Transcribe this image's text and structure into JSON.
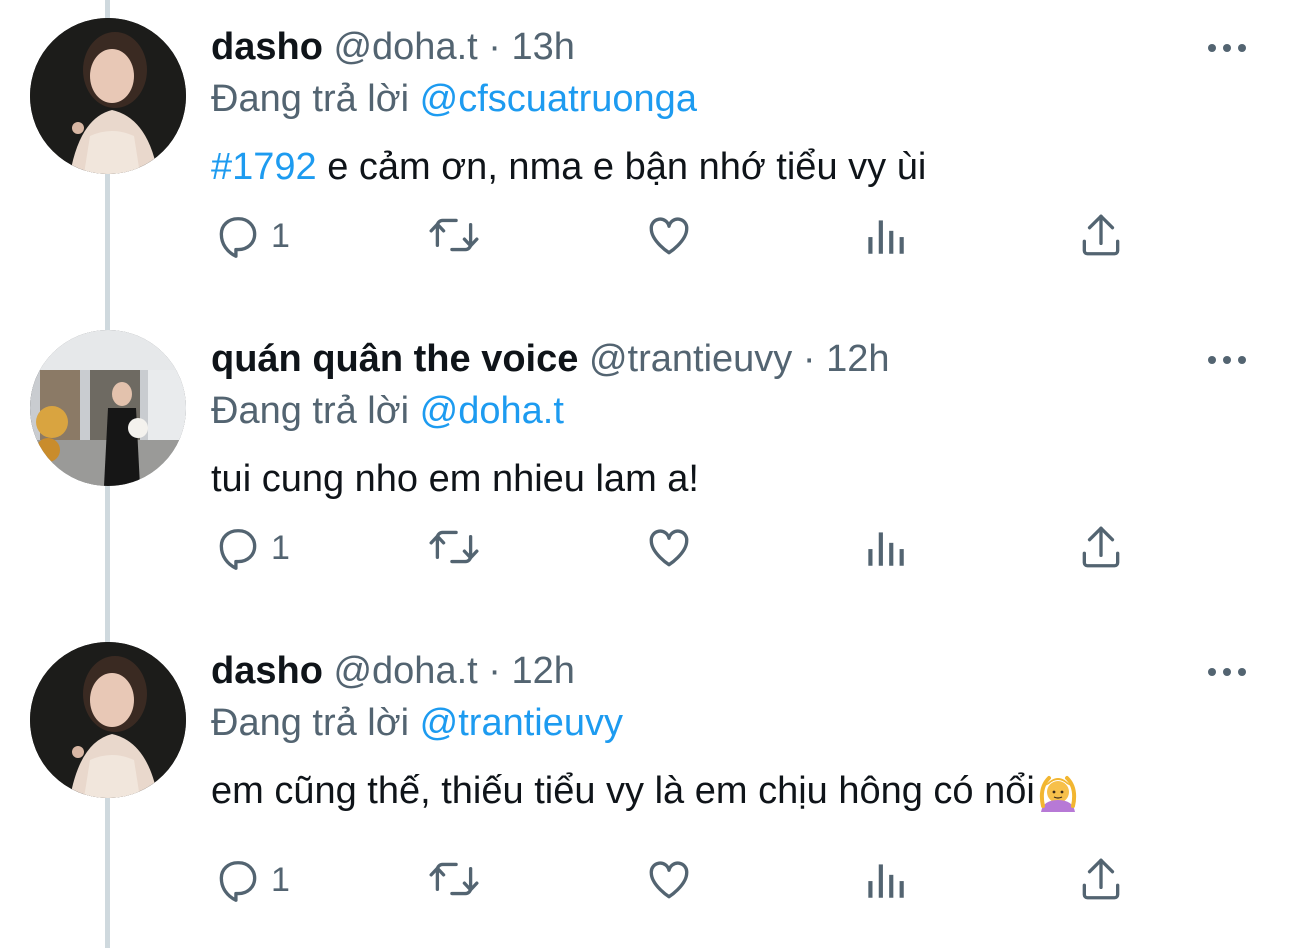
{
  "tweets": [
    {
      "name": "dasho",
      "handle": "@doha.t",
      "separator": "·",
      "time": "13h",
      "reply_prefix": "Đang trả lời",
      "reply_to": "@cfscuatruonga",
      "hashtag": "#1792",
      "text": " e cảm ơn, nma e bận nhớ tiểu vy ùi",
      "reply_count": "1",
      "avatar_icon": "avatar-woman-photo"
    },
    {
      "name": "quán quân the voice",
      "handle": "@trantieuvy",
      "separator": "·",
      "time": "12h",
      "reply_prefix": "Đang trả lời",
      "reply_to": "@doha.t",
      "text": "tui cung nho em nhieu lam a!",
      "reply_count": "1",
      "avatar_icon": "avatar-woman-with-dog-photo"
    },
    {
      "name": "dasho",
      "handle": "@doha.t",
      "separator": "·",
      "time": "12h",
      "reply_prefix": "Đang trả lời",
      "reply_to": "@trantieuvy",
      "text": "em cũng thế, thiếu tiểu vy là em chịu hông có nổi",
      "emoji": "🙆‍♀️",
      "reply_count": "1",
      "avatar_icon": "avatar-woman-photo"
    }
  ],
  "colors": {
    "link": "#1d9bf0",
    "secondary": "#536471",
    "text": "#0f1419",
    "thread_line": "#cfd9de"
  },
  "icons": [
    "reply-icon",
    "retweet-icon",
    "like-icon",
    "views-icon",
    "share-icon",
    "more-icon"
  ]
}
